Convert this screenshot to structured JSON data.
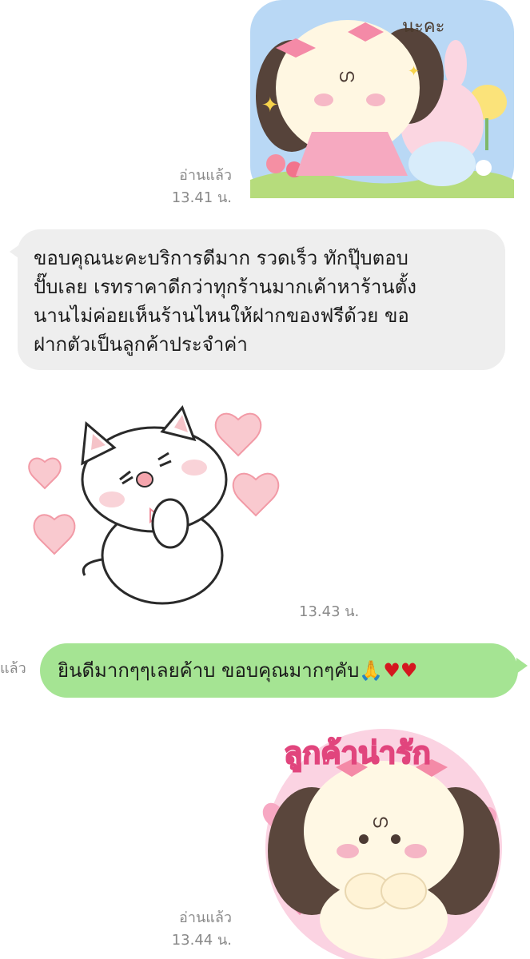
{
  "messages": {
    "sticker_1": {
      "name": "sticker-bunny-girl-flowers",
      "partial_text": "นะคะ",
      "read_label": "อ่านแล้ว",
      "time": "13.41 น."
    },
    "incoming_text": {
      "text": "ขอบคุณนะคะบริการดีมาก รวดเร็ว ทักปุ๊บตอบ\nปั๊บเลย เรทราคาดีกว่าทุกร้านมากเค้าหาร้านตั้ง\nนานไม่ค่อยเห็นร้านไหนให้ฝากของฟรีด้วย ขอ\nฝากตัวเป็นลูกค้าประจำค่า"
    },
    "sticker_2": {
      "name": "sticker-cat-hearts",
      "time": "13.43 น."
    },
    "outgoing_text": {
      "text": "ยินดีมากๆๆเลยค้าบ ขอบคุณมากๆคับ",
      "emoji_pray": "🙏",
      "emoji_heart_1": "♥",
      "emoji_heart_2": "♥",
      "read_label_partial": "แล้ว"
    },
    "sticker_3": {
      "name": "sticker-puppy-customer-cute",
      "sticker_text": "ลูกค้าน่ารัก",
      "read_label": "อ่านแล้ว",
      "time": "13.44 น."
    }
  },
  "colors": {
    "incoming_bubble": "#eeeeee",
    "outgoing_bubble": "#a5e493",
    "meta_text": "#8a8a8a",
    "heart": "#d4171f"
  }
}
